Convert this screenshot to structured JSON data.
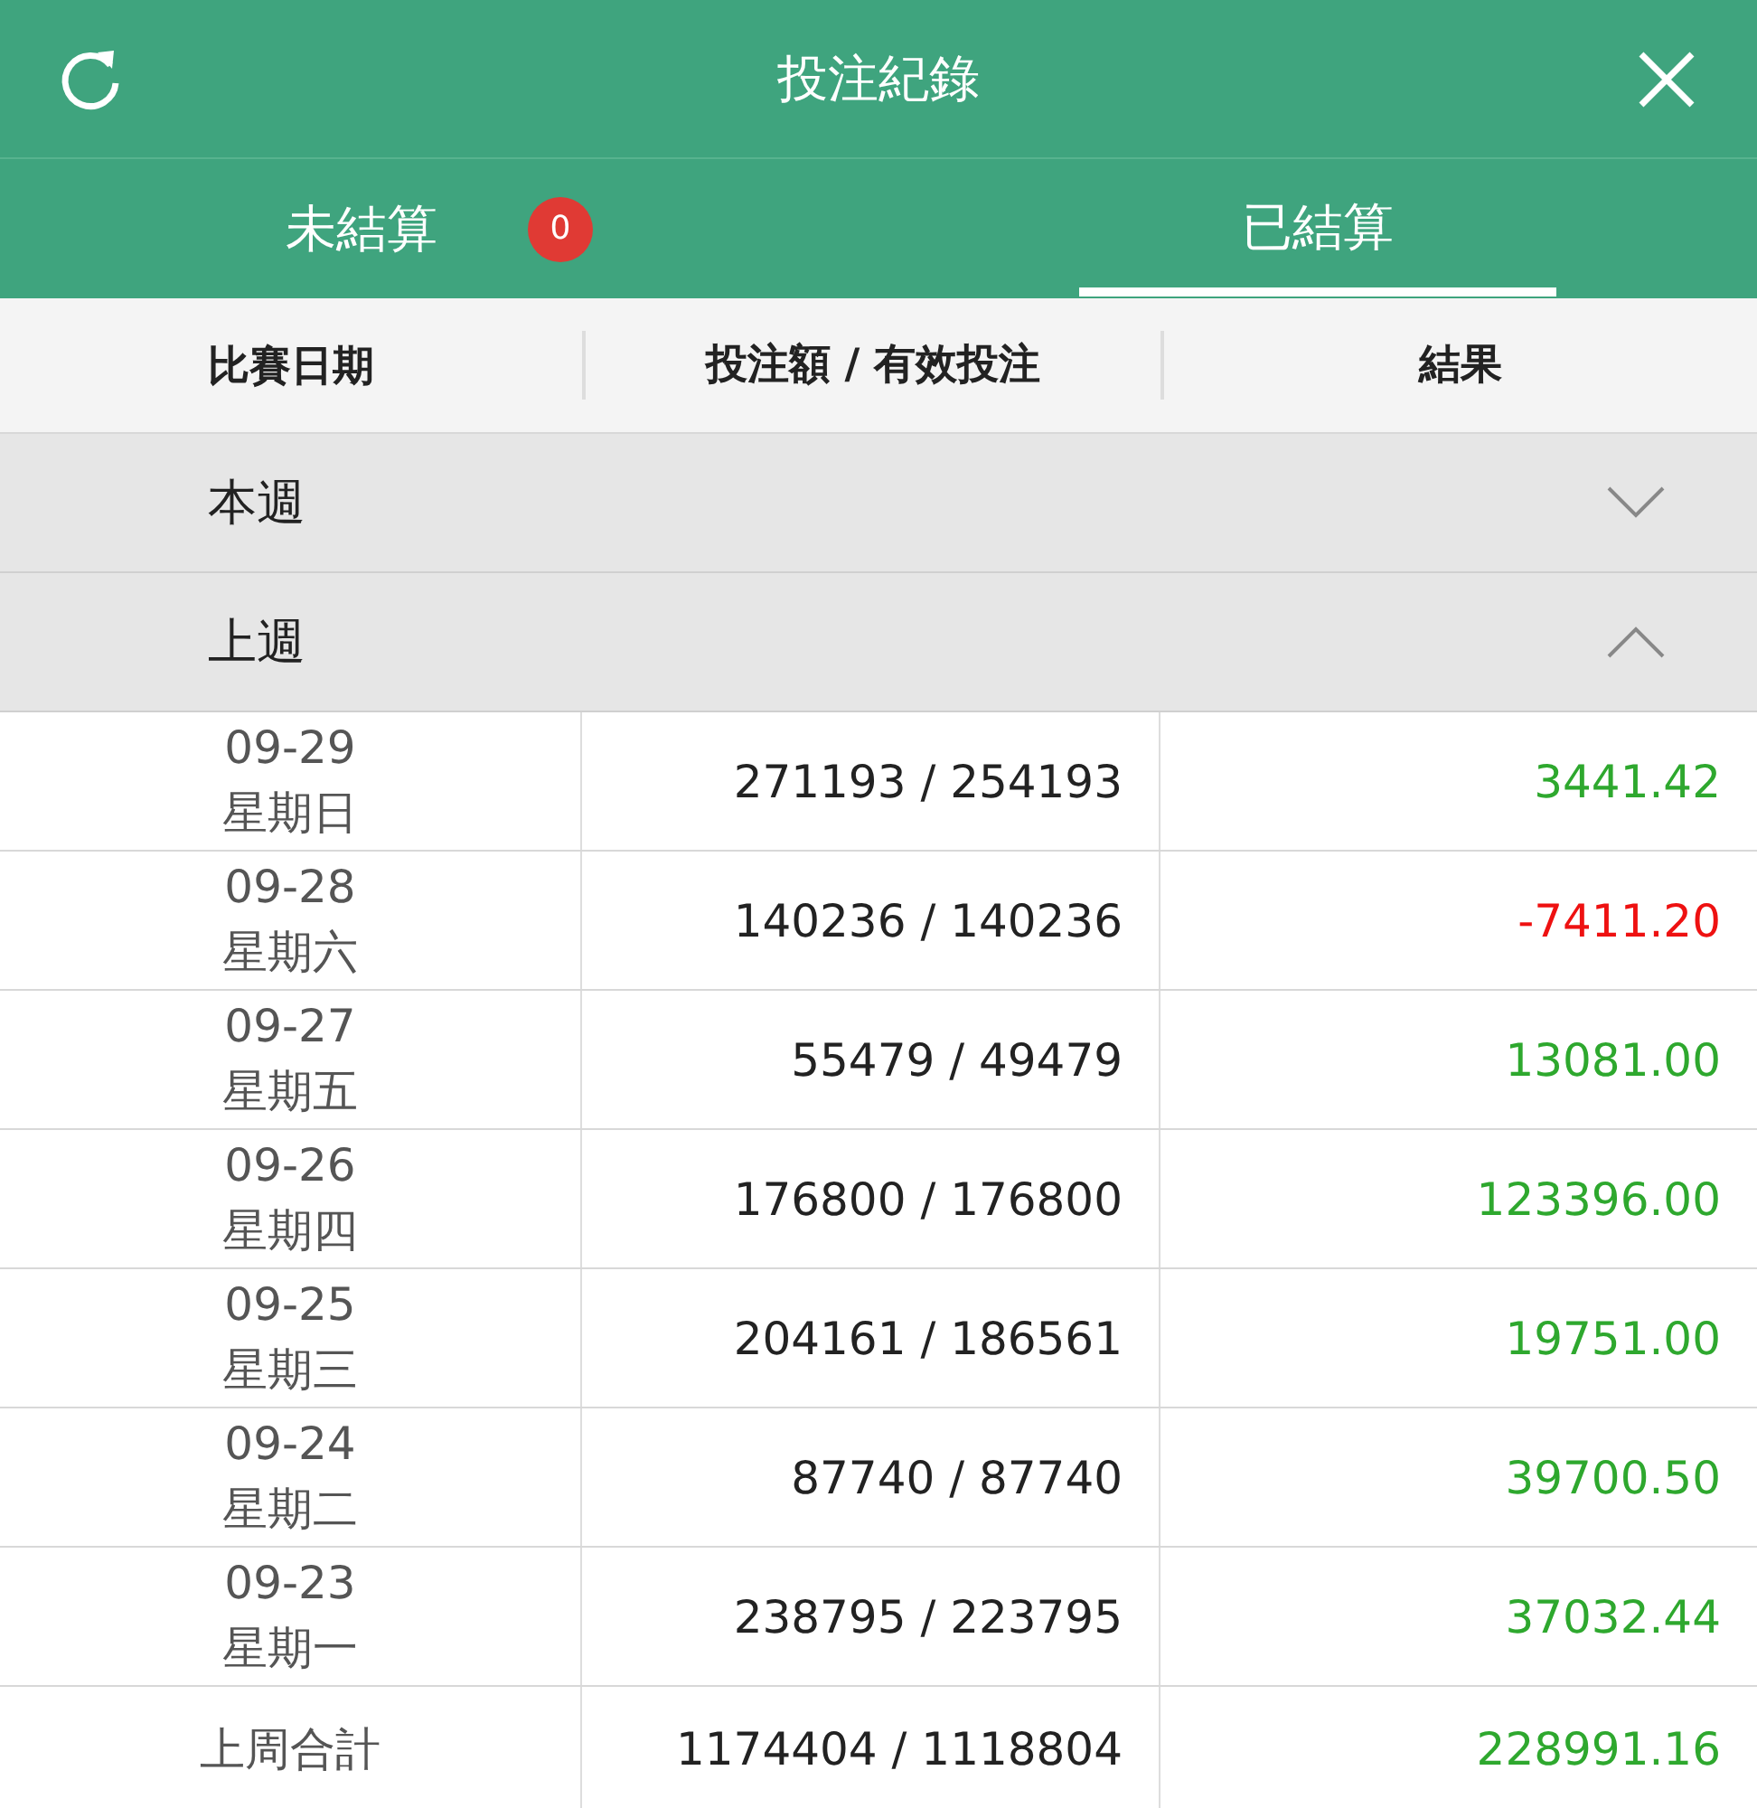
{
  "header": {
    "title": "投注紀錄"
  },
  "tabs": [
    {
      "label": "未結算",
      "badge": "0",
      "selected": false
    },
    {
      "label": "已結算",
      "selected": true
    }
  ],
  "table": {
    "columns": [
      "比賽日期",
      "投注額 / 有效投注",
      "結果"
    ],
    "groups": [
      {
        "label": "本週",
        "expanded": false
      },
      {
        "label": "上週",
        "expanded": true,
        "rows": [
          {
            "date": "09-29",
            "weekday": "星期日",
            "amount": "271193 / 254193",
            "result": "3441.42",
            "negative": false
          },
          {
            "date": "09-28",
            "weekday": "星期六",
            "amount": "140236 / 140236",
            "result": "-7411.20",
            "negative": true
          },
          {
            "date": "09-27",
            "weekday": "星期五",
            "amount": "55479 / 49479",
            "result": "13081.00",
            "negative": false
          },
          {
            "date": "09-26",
            "weekday": "星期四",
            "amount": "176800 / 176800",
            "result": "123396.00",
            "negative": false
          },
          {
            "date": "09-25",
            "weekday": "星期三",
            "amount": "204161 / 186561",
            "result": "19751.00",
            "negative": false
          },
          {
            "date": "09-24",
            "weekday": "星期二",
            "amount": "87740 / 87740",
            "result": "39700.50",
            "negative": false
          },
          {
            "date": "09-23",
            "weekday": "星期一",
            "amount": "238795 / 223795",
            "result": "37032.44",
            "negative": false
          }
        ]
      }
    ],
    "total": {
      "label": "上周合計",
      "amount": "1174404 / 1118804",
      "result": "228991.16",
      "negative": false
    }
  }
}
